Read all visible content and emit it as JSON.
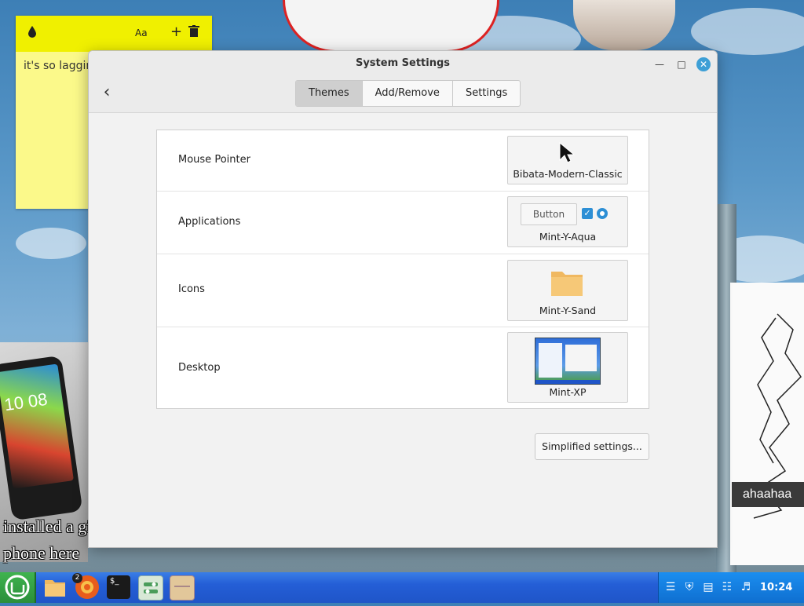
{
  "sticky": {
    "text": "it's so lagging",
    "icons": [
      "color-drop-icon",
      "text-format-icon",
      "add-icon",
      "trash-icon"
    ],
    "color": "#fbf98a"
  },
  "window": {
    "title": "System Settings",
    "tabs": [
      {
        "label": "Themes",
        "active": true
      },
      {
        "label": "Add/Remove",
        "active": false
      },
      {
        "label": "Settings",
        "active": false
      }
    ],
    "rows": [
      {
        "label": "Mouse Pointer",
        "value": "Bibata-Modern-Classic"
      },
      {
        "label": "Applications",
        "value": "Mint-Y-Aqua",
        "preview_button": "Button"
      },
      {
        "label": "Icons",
        "value": "Mint-Y-Sand"
      },
      {
        "label": "Desktop",
        "value": "Mint-XP"
      }
    ],
    "simplified_button": "Simplified settings..."
  },
  "desktop": {
    "phone_clock": "10 08",
    "phone_caption_line1": "installed a gi",
    "phone_caption_line2": "phone here",
    "sketch_caption": "ahaahaa"
  },
  "taskbar": {
    "badge_count": "2",
    "clock": "10:24",
    "accent": "#245ed6"
  }
}
